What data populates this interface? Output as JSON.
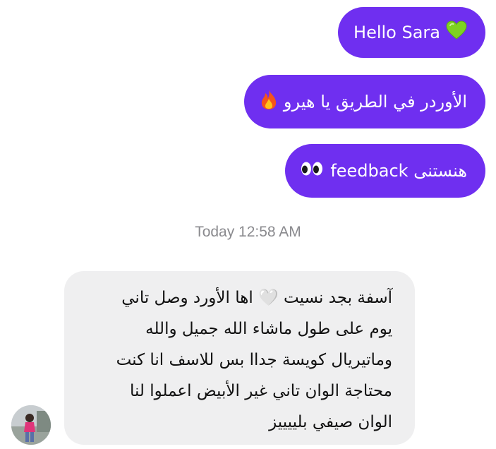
{
  "conversation": {
    "outgoing": [
      {
        "text": "Hello Sara",
        "emoji": "green-heart"
      },
      {
        "text": "الأوردر في الطريق يا هيرو",
        "emoji": "fire"
      },
      {
        "text": "هنستنى feedback",
        "emoji": "eyes"
      }
    ],
    "timestamp": "Today 12:58 AM",
    "incoming": {
      "lines": [
        "آسفة بجد نسيت 🤍 اها الأورد وصل تاني",
        "يوم على طول ماشاء الله جميل والله",
        "وماتيريال كويسة جداا بس للاسف انا كنت",
        "محتاجة الوان تاني غير الأبيض اعملوا لنا",
        "الوان صيفي بلييييز"
      ]
    }
  },
  "colors": {
    "outgoing_bubble": "#6f2ff0",
    "incoming_bubble": "#efeff0",
    "timestamp": "#8a8a8e"
  }
}
